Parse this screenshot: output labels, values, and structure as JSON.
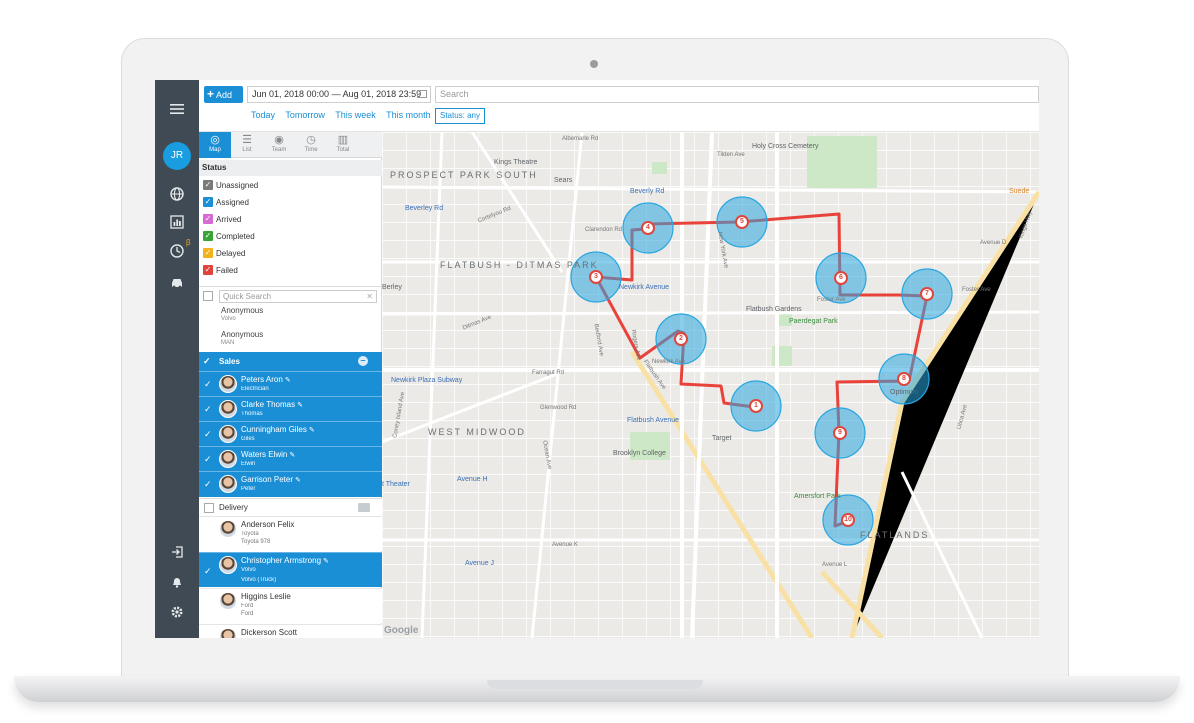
{
  "toolbar": {
    "add_label": "Add",
    "date_range": "Jun 01, 2018 00:00 — Aug 01, 2018 23:59",
    "search_placeholder": "Search",
    "quick_links": [
      "Today",
      "Tomorrow",
      "This week",
      "This month"
    ],
    "status_filter": "Status: any"
  },
  "rail": {
    "avatar_initials": "JR",
    "beta_mark": "β",
    "icons": [
      "menu-icon",
      "globe-icon",
      "chart-icon",
      "clock-icon",
      "car-icon",
      "logout-icon",
      "bell-icon",
      "gear-icon"
    ]
  },
  "view_tabs": [
    "Map",
    "List",
    "Team",
    "Time",
    "Total"
  ],
  "status": {
    "title": "Status",
    "items": [
      {
        "label": "Unassigned",
        "color": "#7a7a7a"
      },
      {
        "label": "Assigned",
        "color": "#1a8fd6"
      },
      {
        "label": "Arrived",
        "color": "#d86ad3"
      },
      {
        "label": "Completed",
        "color": "#3aa537"
      },
      {
        "label": "Delayed",
        "color": "#f3b11b"
      },
      {
        "label": "Failed",
        "color": "#e0453c"
      }
    ]
  },
  "quick_search": {
    "placeholder": "Quick Search"
  },
  "anonymous": [
    {
      "name": "Anonymous",
      "vehicle": "Volvo"
    },
    {
      "name": "Anonymous",
      "vehicle": "MAN"
    }
  ],
  "groups": {
    "sales": {
      "label": "Sales",
      "members": [
        {
          "name": "Peters Aron",
          "sub": "Electrician"
        },
        {
          "name": "Clarke Thomas",
          "sub": "Thomas"
        },
        {
          "name": "Cunningham Giles",
          "sub": "Giles"
        },
        {
          "name": "Waters Elwin",
          "sub": "Elwin"
        },
        {
          "name": "Garrison Peter",
          "sub": "Peter"
        }
      ]
    },
    "delivery": {
      "label": "Delivery",
      "members": [
        {
          "name": "Anderson Felix",
          "sub": "Toyota",
          "sub2": "Toyota 978",
          "selected": false
        },
        {
          "name": "Christopher Armstrong",
          "sub": "Volvo",
          "sub2": "Volvo (Truck)",
          "selected": true
        },
        {
          "name": "Higgins Leslie",
          "sub": "Ford",
          "sub2": "Ford",
          "selected": false
        },
        {
          "name": "Dickerson Scott",
          "sub": "",
          "sub2": "",
          "selected": false
        }
      ]
    }
  },
  "map": {
    "route_color": "#e9423a",
    "stop_color": "#29a6e0",
    "stops": [
      "1",
      "2",
      "3",
      "4",
      "5",
      "6",
      "7",
      "8",
      "9",
      "10"
    ],
    "places": {
      "prospect_park_south": "PROSPECT PARK SOUTH",
      "flatbush_ditmas_park": "FLATBUSH - DITMAS PARK",
      "west_midwood": "WEST MIDWOOD",
      "flatlands": "FLATLANDS",
      "kings_theatre": "Kings Theatre",
      "sears": "Sears",
      "holy_cross": "Holy Cross Cemetery",
      "beverly_rd_m": "Beverly Rd",
      "beverley_rd_m": "Beverley Rd",
      "newkirk_ave_m": "Newkirk Avenue",
      "newkirk_plaza": "Newkirk Plaza Subway",
      "flatbush_gardens": "Flatbush Gardens",
      "paerdegat_park": "Paerdegat Park",
      "flatbush_ave_m": "Flatbush Avenue",
      "target": "Target",
      "brooklyn_college": "Brooklyn College",
      "optimum": "Optimum",
      "amersfort_park": "Amersfort Park",
      "avenue_h": "Avenue H",
      "avenue_j": "Avenue J",
      "suede": "Suede",
      "theater": "t Theater",
      "berley": "Berley",
      "google": "Google"
    },
    "roads": {
      "tilden_ave": "Tilden Ave",
      "clarendon_rd": "Clarendon Rd",
      "foster_ave": "Foster Ave",
      "foster_ave_2": "Foster Ave",
      "avenue_d": "Avenue D",
      "newkirk_ave": "Newkirk Ave",
      "farragut_rd": "Farragut Rd",
      "glenwood_rd": "Glenwood Rd",
      "avenue_k": "Avenue K",
      "avenue_l": "Avenue L",
      "kings_hwy": "Kings Hwy",
      "flatbush_ave": "Flatbush Ave",
      "new_york_ave": "New York Ave",
      "bedford_ave": "Bedford Ave",
      "rogers_ave": "Rogers Ave",
      "ocean_ave": "Ocean Ave",
      "coney_island_ave": "Coney Island Ave",
      "ditmas_ave": "Ditmas Ave",
      "cortelyou_rd": "Cortelyou Rd",
      "utica_ave": "Utica Ave",
      "albemarle_rd": "Albemarle Rd"
    }
  }
}
